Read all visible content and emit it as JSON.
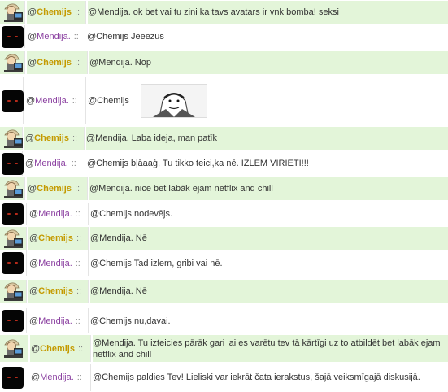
{
  "users": {
    "chemijs": {
      "at": "@",
      "name": "Chemijs",
      "sep": "::",
      "avatar_icon": "chemijs-avatar-icon"
    },
    "mendija": {
      "at": "@",
      "name": "Mendija.",
      "sep": "::",
      "avatar_icon": "mendija-avatar-icon"
    }
  },
  "messages": [
    {
      "user": "chemijs",
      "text": "@Mendija. ok bet vai tu zini ka tavs avatars ir vnk bomba! seksi"
    },
    {
      "user": "mendija",
      "text": "@Chemijs Jeeezus"
    },
    {
      "user": "chemijs",
      "text": "@Mendija. Nop"
    },
    {
      "user": "mendija",
      "text": "@Chemijs",
      "image": "meme-face-image"
    },
    {
      "user": "chemijs",
      "text": "@Mendija. Laba ideja, man patīk"
    },
    {
      "user": "mendija",
      "text": "@Chemijs bļāaaģ, Tu tikko teici,ka nē. IZLEM VĪRIETI!!!"
    },
    {
      "user": "chemijs",
      "text": "@Mendija. nice bet labāk ejam netflix and chill"
    },
    {
      "user": "mendija",
      "text": "@Chemijs nodevējs."
    },
    {
      "user": "chemijs",
      "text": "@Mendija. Nē"
    },
    {
      "user": "mendija",
      "text": "@Chemijs Tad izlem, gribi vai nē."
    },
    {
      "user": "chemijs",
      "text": "@Mendija. Nē"
    },
    {
      "user": "mendija",
      "text": "@Chemijs nu,davai."
    },
    {
      "user": "chemijs",
      "text": "@Mendija. Tu izteicies pārāk gari lai es varētu tev tā kārtīgi uz to atbildēt bet labāk ejam netflix and chill"
    },
    {
      "user": "mendija",
      "text": "@Chemijs paldies Tev! Lieliski var iekrāt čata ierakstus, šajā veiksmīgajā diskusijā."
    }
  ],
  "colors": {
    "green_row": "#e3f5d9",
    "chemijs_name": "#c49a00",
    "mendija_name": "#8a3fa0"
  }
}
